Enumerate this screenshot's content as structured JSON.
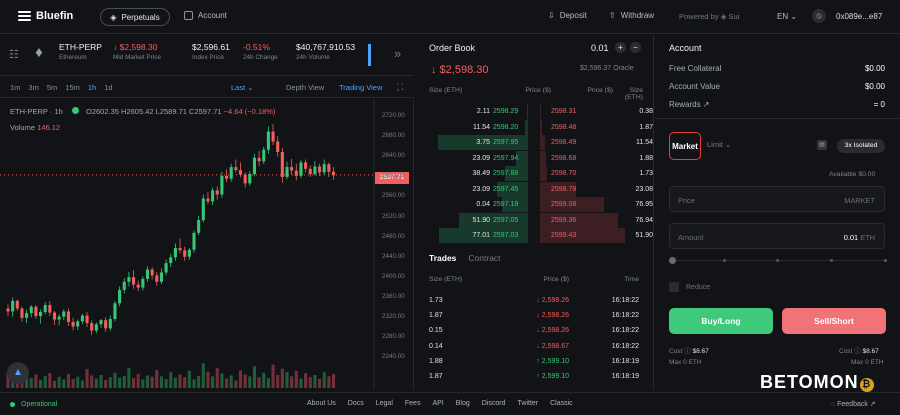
{
  "topbar": {
    "brand": "Bluefin",
    "tabs": [
      {
        "label": "Perpetuals",
        "icon": "shield-grid-icon"
      },
      {
        "label": "Account",
        "icon": "account-card-icon"
      }
    ],
    "deposit": "Deposit",
    "withdraw": "Withdraw",
    "powered": "Powered by ◈ Sui",
    "language": "EN",
    "wallet": "0x089e...e87"
  },
  "market": {
    "symbol": "ETH-PERP",
    "asset": "Ethereum",
    "mid_price": "↓ $2,598.30",
    "mid_label": "Mid Market Price",
    "index_price": "$2,596.61",
    "index_label": "Index Price",
    "change": "-0.51%",
    "change_label": "24h Change",
    "volume": "$40,767,910.53",
    "volume_label": "24h Volume"
  },
  "chart_toolbar": {
    "timeframes": [
      "1m",
      "3m",
      "5m",
      "15m",
      "1h",
      "1d"
    ],
    "active_timeframe": "1h",
    "last": "Last",
    "depth": "Depth View",
    "trading": "Trading View"
  },
  "chart_data": {
    "type": "candlestick",
    "symbol": "ETH-PERP · 1h",
    "ohlc": {
      "open": "O2602.35",
      "high": "H2605.42",
      "low": "L2589.71",
      "close": "C2597.71",
      "change": "−4.64 (−0.18%)"
    },
    "volume_label": "Volume",
    "volume_value": "146.12",
    "y_ticks": [
      "2720.00",
      "2680.00",
      "2640.00",
      "2600.00",
      "2560.00",
      "2520.00",
      "2480.00",
      "2440.00",
      "2400.00",
      "2360.00",
      "2320.00",
      "2280.00",
      "2240.00"
    ],
    "last_price": "2597.71",
    "ylim": [
      2228,
      2728
    ],
    "candles": [
      [
        2368,
        2375,
        2355,
        2363
      ],
      [
        2363,
        2387,
        2354,
        2381
      ],
      [
        2381,
        2384,
        2364,
        2368
      ],
      [
        2368,
        2371,
        2345,
        2352
      ],
      [
        2352,
        2366,
        2343,
        2360
      ],
      [
        2360,
        2374,
        2353,
        2371
      ],
      [
        2371,
        2374,
        2350,
        2355
      ],
      [
        2355,
        2366,
        2342,
        2362
      ],
      [
        2362,
        2379,
        2358,
        2374
      ],
      [
        2374,
        2381,
        2355,
        2361
      ],
      [
        2361,
        2364,
        2340,
        2349
      ],
      [
        2349,
        2358,
        2339,
        2354
      ],
      [
        2354,
        2367,
        2348,
        2363
      ],
      [
        2363,
        2368,
        2338,
        2345
      ],
      [
        2345,
        2352,
        2330,
        2337
      ],
      [
        2337,
        2349,
        2331,
        2346
      ],
      [
        2346,
        2359,
        2341,
        2356
      ],
      [
        2356,
        2362,
        2336,
        2343
      ],
      [
        2343,
        2348,
        2322,
        2330
      ],
      [
        2330,
        2344,
        2326,
        2341
      ],
      [
        2341,
        2350,
        2335,
        2348
      ],
      [
        2348,
        2353,
        2328,
        2334
      ],
      [
        2334,
        2356,
        2330,
        2350
      ],
      [
        2350,
        2381,
        2346,
        2377
      ],
      [
        2377,
        2406,
        2372,
        2400
      ],
      [
        2400,
        2420,
        2394,
        2414
      ],
      [
        2414,
        2431,
        2406,
        2422
      ],
      [
        2422,
        2434,
        2402,
        2409
      ],
      [
        2409,
        2416,
        2398,
        2404
      ],
      [
        2404,
        2423,
        2399,
        2419
      ],
      [
        2419,
        2441,
        2414,
        2435
      ],
      [
        2435,
        2439,
        2418,
        2425
      ],
      [
        2425,
        2431,
        2407,
        2414
      ],
      [
        2414,
        2437,
        2410,
        2430
      ],
      [
        2430,
        2452,
        2425,
        2446
      ],
      [
        2446,
        2462,
        2439,
        2456
      ],
      [
        2456,
        2480,
        2450,
        2472
      ],
      [
        2472,
        2488,
        2463,
        2468
      ],
      [
        2468,
        2474,
        2450,
        2457
      ],
      [
        2457,
        2472,
        2452,
        2469
      ],
      [
        2469,
        2502,
        2464,
        2498
      ],
      [
        2498,
        2527,
        2494,
        2520
      ],
      [
        2520,
        2564,
        2516,
        2557
      ],
      [
        2557,
        2568,
        2547,
        2552
      ],
      [
        2552,
        2576,
        2546,
        2571
      ],
      [
        2571,
        2578,
        2555,
        2564
      ],
      [
        2564,
        2603,
        2558,
        2596
      ],
      [
        2596,
        2607,
        2585,
        2591
      ],
      [
        2591,
        2617,
        2586,
        2611
      ],
      [
        2611,
        2624,
        2602,
        2606
      ],
      [
        2606,
        2619,
        2593,
        2598
      ],
      [
        2598,
        2602,
        2576,
        2583
      ],
      [
        2583,
        2604,
        2579,
        2599
      ],
      [
        2599,
        2634,
        2595,
        2627
      ],
      [
        2627,
        2639,
        2613,
        2621
      ],
      [
        2621,
        2646,
        2616,
        2641
      ],
      [
        2641,
        2681,
        2634,
        2672
      ],
      [
        2672,
        2685,
        2649,
        2655
      ],
      [
        2655,
        2664,
        2629,
        2637
      ],
      [
        2637,
        2644,
        2584,
        2594
      ],
      [
        2594,
        2620,
        2590,
        2611
      ],
      [
        2611,
        2625,
        2598,
        2605
      ],
      [
        2605,
        2617,
        2588,
        2596
      ],
      [
        2596,
        2623,
        2592,
        2619
      ],
      [
        2619,
        2624,
        2602,
        2608
      ],
      [
        2608,
        2614,
        2594,
        2599
      ],
      [
        2599,
        2621,
        2596,
        2612
      ],
      [
        2612,
        2617,
        2596,
        2602
      ],
      [
        2602,
        2624,
        2597,
        2616
      ],
      [
        2616,
        2619,
        2594,
        2603
      ],
      [
        2603,
        2611,
        2589,
        2597
      ]
    ],
    "volumes": [
      32,
      18,
      24,
      20,
      36,
      22,
      30,
      18,
      27,
      33,
      16,
      25,
      19,
      31,
      20,
      25,
      17,
      42,
      28,
      21,
      29,
      18,
      24,
      34,
      23,
      27,
      44,
      22,
      31,
      19,
      28,
      25,
      40,
      26,
      20,
      35,
      23,
      30,
      24,
      38,
      19,
      27,
      55,
      36,
      26,
      44,
      32,
      21,
      28,
      17,
      39,
      30,
      26,
      48,
      24,
      34,
      22,
      52,
      29,
      43,
      35,
      26,
      38,
      21,
      33,
      24,
      29,
      20,
      35,
      26,
      31
    ]
  },
  "orderbook": {
    "title": "Order Book",
    "step": "0.01",
    "price": "↓ $2,598.30",
    "oracle": "$2,596.37 Oracle",
    "headers": [
      "Size (ETH)",
      "Price ($)",
      "Price ($)",
      "Size (ETH)"
    ],
    "rows": [
      {
        "bid_size": "2.11",
        "bid_price": "2598.29",
        "ask_price": "2598.31",
        "ask_size": "0.38",
        "bid_depth": 0.01,
        "ask_depth": 0.01
      },
      {
        "bid_size": "11.54",
        "bid_price": "2598.20",
        "ask_price": "2598.48",
        "ask_size": "1.87",
        "bid_depth": 0.03,
        "ask_depth": 0.02
      },
      {
        "bid_size": "3.75",
        "bid_price": "2597.95",
        "ask_price": "2598.49",
        "ask_size": "11.54",
        "bid_depth": 0.87,
        "ask_depth": 0.05
      },
      {
        "bid_size": "23.09",
        "bid_price": "2597.94",
        "ask_price": "2598.68",
        "ask_size": "1.88",
        "bid_depth": 0.12,
        "ask_depth": 0.06
      },
      {
        "bid_size": "38.49",
        "bid_price": "2597.88",
        "ask_price": "2598.70",
        "ask_size": "1.73",
        "bid_depth": 0.22,
        "ask_depth": 0.07
      },
      {
        "bid_size": "23.09",
        "bid_price": "2597.45",
        "ask_price": "2598.78",
        "ask_size": "23.08",
        "bid_depth": 0.3,
        "ask_depth": 0.35
      },
      {
        "bid_size": "0.04",
        "bid_price": "2597.19",
        "ask_price": "2599.08",
        "ask_size": "76.95",
        "bid_depth": 0.25,
        "ask_depth": 0.62
      },
      {
        "bid_size": "51.90",
        "bid_price": "2597.05",
        "ask_price": "2599.36",
        "ask_size": "76.94",
        "bid_depth": 0.66,
        "ask_depth": 0.75
      },
      {
        "bid_size": "77.01",
        "bid_price": "2597.03",
        "ask_price": "2599.43",
        "ask_size": "51.90",
        "bid_depth": 0.86,
        "ask_depth": 0.82
      }
    ]
  },
  "trades": {
    "tabs": [
      "Trades",
      "Contract"
    ],
    "headers": [
      "Size (ETH)",
      "Price ($)",
      "Time"
    ],
    "rows": [
      {
        "size": "1.73",
        "price": "↓ 2,598.26",
        "time": "16:18:22",
        "side": "sell"
      },
      {
        "size": "1.87",
        "price": "↓ 2,598.26",
        "time": "16:18:22",
        "side": "sell"
      },
      {
        "size": "0.15",
        "price": "↓ 2,598.26",
        "time": "16:18:22",
        "side": "sell"
      },
      {
        "size": "0.14",
        "price": "↓ 2,598.67",
        "time": "16:18:22",
        "side": "sell"
      },
      {
        "size": "1.88",
        "price": "↑ 2,599.10",
        "time": "16:18:19",
        "side": "buy"
      },
      {
        "size": "1.87",
        "price": "↑ 2,599.10",
        "time": "16:18:19",
        "side": "buy"
      }
    ]
  },
  "account": {
    "title": "Account",
    "free_collateral_label": "Free Collateral",
    "free_collateral": "$0.00",
    "account_value_label": "Account Value",
    "account_value": "$0.00",
    "rewards_label": "Rewards ↗",
    "rewards": "= 0",
    "market_tab": "Market",
    "limit_tab": "Limit ⌄",
    "leverage": "3x Isolated",
    "available": "Available  $0.00",
    "price_label": "Price",
    "price_value": "MARKET",
    "amount_label": "Amount",
    "amount_value": "0.01",
    "amount_unit": "ETH",
    "reduce": "Reduce",
    "buy": "Buy/Long",
    "sell": "Sell/Short",
    "cost_label": "Cost",
    "cost_value": "$8.67",
    "max_label": "Max",
    "max_value": "0 ETH"
  },
  "footer": {
    "status": "Operational",
    "links": [
      "About Us",
      "Docs",
      "Legal",
      "Fees",
      "API",
      "Blog",
      "Discord",
      "Twitter",
      "Classic"
    ],
    "feedback": "Feedback ↗",
    "watermark": "BETOMON"
  },
  "colors": {
    "up": "#35c777",
    "down": "#f45e5e",
    "accent": "#4fa3ff",
    "background": "#121316"
  }
}
